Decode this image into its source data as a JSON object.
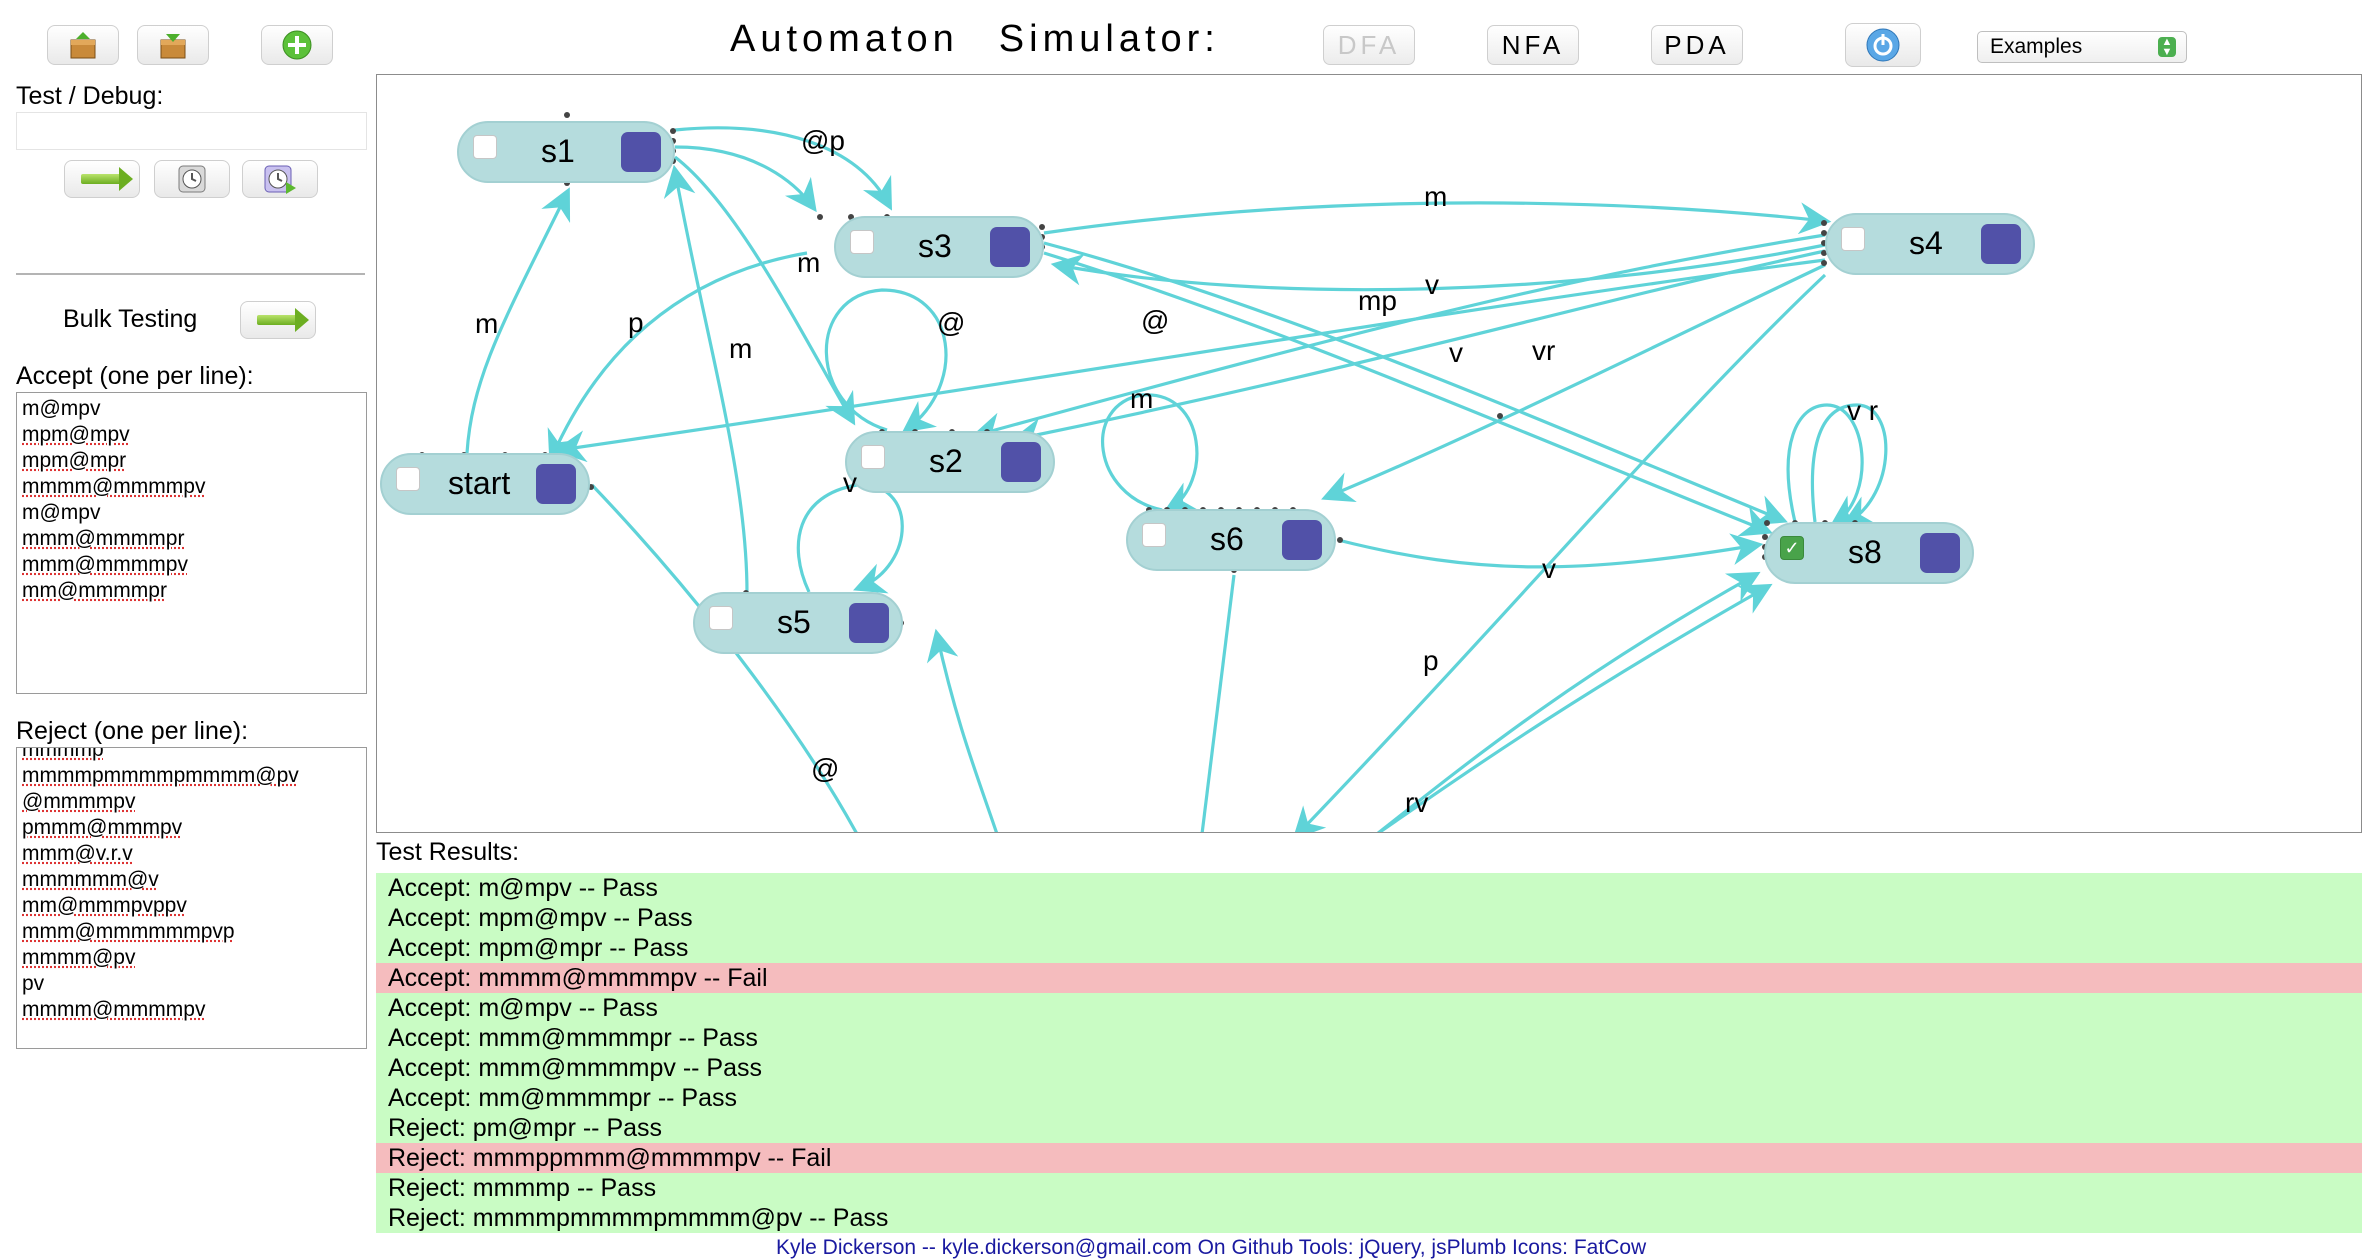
{
  "header": {
    "title_a": "Automaton",
    "title_b": "Simulator:",
    "modes": [
      "DFA",
      "NFA",
      "PDA"
    ],
    "examples_select": "Examples"
  },
  "sidebar": {
    "test_debug_label": "Test / Debug:",
    "test_input_value": "",
    "bulk_label": "Bulk Testing",
    "accept_label": "Accept (one per line):",
    "accept_lines": [
      "m@mpv",
      "mpm@mpv",
      "mpm@mpr",
      "mmmm@mmmmpv",
      "m@mpv",
      "mmm@mmmmpr",
      "mmm@mmmmpv",
      "mm@mmmmpr"
    ],
    "reject_label": "Reject (one per line):",
    "reject_partial": "mmmmp",
    "reject_lines": [
      "mmmmpmmmmpmmmm@pv",
      "@mmmmpv",
      "pmmm@mmmpv",
      "mmm@v.r.v",
      "mmmmmm@v",
      "mm@mmmpvppv",
      "mmm@mmmmmmpvp",
      "mmmm@pv",
      "pv",
      "mmmm@mmmmpv"
    ]
  },
  "diagram": {
    "states": [
      "s1",
      "s3",
      "s4",
      "start",
      "s2",
      "s6",
      "s8",
      "s5"
    ],
    "labels": [
      "@p",
      "m",
      "m",
      "p",
      "m",
      "@",
      "@",
      "v",
      "mp",
      "v",
      "vr",
      "m",
      "m",
      "v",
      "v",
      "v r",
      "@",
      "p",
      "rv"
    ]
  },
  "results": {
    "label": "Test Results:",
    "rows": [
      {
        "text": "Accept: m@mpv -- Pass",
        "status": "pass"
      },
      {
        "text": "Accept: mpm@mpv -- Pass",
        "status": "pass"
      },
      {
        "text": "Accept: mpm@mpr -- Pass",
        "status": "pass"
      },
      {
        "text": "Accept: mmmm@mmmmpv -- Fail",
        "status": "fail"
      },
      {
        "text": "Accept: m@mpv -- Pass",
        "status": "pass"
      },
      {
        "text": "Accept: mmm@mmmmpr -- Pass",
        "status": "pass"
      },
      {
        "text": "Accept: mmm@mmmmpv -- Pass",
        "status": "pass"
      },
      {
        "text": "Accept: mm@mmmmpr -- Pass",
        "status": "pass"
      },
      {
        "text": "Reject: pm@mpr -- Pass",
        "status": "pass"
      },
      {
        "text": "Reject: mmmppmmm@mmmmpv -- Fail",
        "status": "fail"
      },
      {
        "text": "Reject: mmmmp -- Pass",
        "status": "pass"
      },
      {
        "text": "Reject: mmmmpmmmmpmmmm@pv -- Pass",
        "status": "pass"
      }
    ]
  },
  "footer": {
    "text": "Kyle Dickerson -- kyle.dickerson@gmail.com  On Github   Tools: jQuery, jsPlumb  Icons: FatCow"
  },
  "colors": {
    "edge": "#5fd3d8",
    "state_fill": "#b5dcdd",
    "state_square": "#5151a8",
    "pass": "#c9fcc4",
    "fail": "#f5bcbe"
  }
}
